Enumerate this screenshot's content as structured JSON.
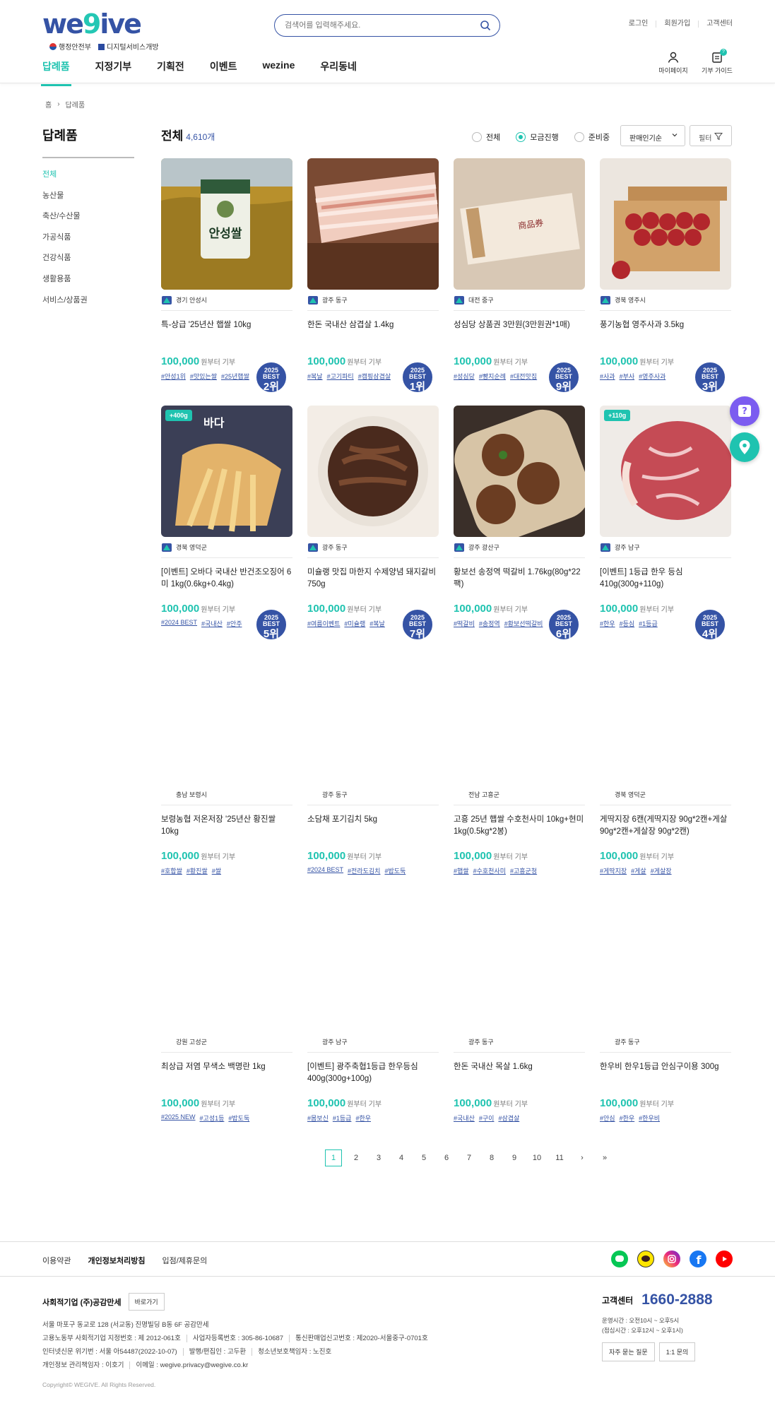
{
  "header": {
    "logo": {
      "part1": "we",
      "part2": "9",
      "part3": "ive"
    },
    "logo_sub": [
      "행정안전부",
      "디지털서비스개방"
    ],
    "search_placeholder": "검색어를 입력해주세요.",
    "top_links": [
      "로그인",
      "회원가입",
      "고객센터"
    ],
    "nav": [
      "답례품",
      "지정기부",
      "기획전",
      "이벤트",
      "wezine",
      "우리동네"
    ],
    "icons": [
      {
        "label": "마이페이지",
        "icon": "user-icon"
      },
      {
        "label": "기부 가이드",
        "icon": "guide-icon"
      }
    ],
    "guide_badge": "?"
  },
  "breadcrumb": [
    "홈",
    "답례품"
  ],
  "sidebar": {
    "title": "답례품",
    "items": [
      "전체",
      "농산물",
      "축산/수산물",
      "가공식품",
      "건강식품",
      "생활용품",
      "서비스/상품권"
    ]
  },
  "list": {
    "title": "전체",
    "count": "4,610개",
    "filters": [
      "전체",
      "모금진행",
      "준비중"
    ],
    "selected_filter": "모금진행",
    "sort": "판매인기순",
    "filter_btn": "필터"
  },
  "products": [
    {
      "region": "경기 안성시",
      "name": "특-상급 '25년산 햅쌀 10kg",
      "price": "100,000",
      "unit": "원부터 기부",
      "tags": [
        "#안성1위",
        "#맛있는쌀",
        "#25년햅쌀"
      ],
      "badge_top": "2025",
      "badge_mid": "BEST",
      "rank": "2위",
      "plus": "",
      "img": "rice"
    },
    {
      "region": "광주 동구",
      "name": "한돈 국내산 삼겹살 1.4kg",
      "price": "100,000",
      "unit": "원부터 기부",
      "tags": [
        "#복날",
        "#고기파티",
        "#캠핑삼겹살"
      ],
      "badge_top": "2025",
      "badge_mid": "BEST",
      "rank": "1위",
      "plus": "",
      "img": "pork"
    },
    {
      "region": "대전 중구",
      "name": "성심당 상품권 3만원(3만원권*1매)",
      "price": "100,000",
      "unit": "원부터 기부",
      "tags": [
        "#성심당",
        "#빵지순례",
        "#대전맛집"
      ],
      "badge_top": "2025",
      "badge_mid": "BEST",
      "rank": "9위",
      "plus": "",
      "img": "voucher"
    },
    {
      "region": "경북 영주시",
      "name": "풍기농협 영주사과 3.5kg",
      "price": "100,000",
      "unit": "원부터 기부",
      "tags": [
        "#사과",
        "#부사",
        "#영주사과"
      ],
      "badge_top": "2025",
      "badge_mid": "BEST",
      "rank": "3위",
      "plus": "",
      "img": "apple"
    },
    {
      "region": "경북 영덕군",
      "name": "[이벤트] 오바다 국내산 반건조오징어 6미 1kg(0.6kg+0.4kg)",
      "price": "100,000",
      "unit": "원부터 기부",
      "tags": [
        "#2024 BEST",
        "#국내산",
        "#안주"
      ],
      "badge_top": "2025",
      "badge_mid": "BEST",
      "rank": "5위",
      "plus": "+400g",
      "img": "squid"
    },
    {
      "region": "광주 동구",
      "name": "미슐랭 맛집 마한지 수제양념 돼지갈비 750g",
      "price": "100,000",
      "unit": "원부터 기부",
      "tags": [
        "#여름이벤트",
        "#미슐랭",
        "#복날"
      ],
      "badge_top": "2025",
      "badge_mid": "BEST",
      "rank": "7위",
      "plus": "",
      "img": "galbi"
    },
    {
      "region": "광주 광산구",
      "name": "황보선 송정역 떡갈비 1.76kg(80g*22팩)",
      "price": "100,000",
      "unit": "원부터 기부",
      "tags": [
        "#떡갈비",
        "#송정역",
        "#황보선떡갈비"
      ],
      "badge_top": "2025",
      "badge_mid": "BEST",
      "rank": "6위",
      "plus": "",
      "img": "tteok"
    },
    {
      "region": "광주 남구",
      "name": "[이벤트] 1등급 한우 등심 410g(300g+110g)",
      "price": "100,000",
      "unit": "원부터 기부",
      "tags": [
        "#한우",
        "#등심",
        "#1등급"
      ],
      "badge_top": "2025",
      "badge_mid": "BEST",
      "rank": "4위",
      "plus": "+110g",
      "img": "beef"
    },
    {
      "region": "충남 보령시",
      "name": "보령농협 저온저장 '25년산 황진쌀10kg",
      "price": "100,000",
      "unit": "원부터 기부",
      "tags": [
        "#호합쌀",
        "#황진쌀",
        "#쌀"
      ],
      "badge_top": "",
      "badge_mid": "",
      "rank": "",
      "plus": "",
      "img": ""
    },
    {
      "region": "광주 동구",
      "name": "소담채 포기김치 5kg",
      "price": "100,000",
      "unit": "원부터 기부",
      "tags": [
        "#2024 BEST",
        "#전라도김치",
        "#밥도둑"
      ],
      "badge_top": "",
      "badge_mid": "",
      "rank": "",
      "plus": "",
      "img": ""
    },
    {
      "region": "전남 고흥군",
      "name": "고흥 25년 햅쌀 수호천사미 10kg+현미1kg(0.5kg*2봉)",
      "price": "100,000",
      "unit": "원부터 기부",
      "tags": [
        "#햅쌀",
        "#수호천사미",
        "#고흥군청"
      ],
      "badge_top": "",
      "badge_mid": "",
      "rank": "",
      "plus": "",
      "img": ""
    },
    {
      "region": "경북 영덕군",
      "name": "게딱지장 6캔(게딱지장 90g*2캔+게살90g*2캔+게살장 90g*2캔)",
      "price": "100,000",
      "unit": "원부터 기부",
      "tags": [
        "#게딱지장",
        "#게살",
        "#게살장"
      ],
      "badge_top": "",
      "badge_mid": "",
      "rank": "",
      "plus": "",
      "img": ""
    },
    {
      "region": "강원 고성군",
      "name": "최상급 저염 무색소 백명란 1kg",
      "price": "100,000",
      "unit": "원부터 기부",
      "tags": [
        "#2025 NEW",
        "#고성1등",
        "#밥도둑"
      ],
      "badge_top": "",
      "badge_mid": "",
      "rank": "",
      "plus": "",
      "img": ""
    },
    {
      "region": "광주 남구",
      "name": "[이벤트] 광주축협1등급 한우등심 400g(300g+100g)",
      "price": "100,000",
      "unit": "원부터 기부",
      "tags": [
        "#몸보신",
        "#1등급",
        "#한우"
      ],
      "badge_top": "",
      "badge_mid": "",
      "rank": "",
      "plus": "",
      "img": ""
    },
    {
      "region": "광주 동구",
      "name": "한돈 국내산 목살 1.6kg",
      "price": "100,000",
      "unit": "원부터 기부",
      "tags": [
        "#국내산",
        "#구이",
        "#삼겹살"
      ],
      "badge_top": "",
      "badge_mid": "",
      "rank": "",
      "plus": "",
      "img": ""
    },
    {
      "region": "광주 동구",
      "name": "한우비 한우1등급 안심구이용 300g",
      "price": "100,000",
      "unit": "원부터 기부",
      "tags": [
        "#안심",
        "#한우",
        "#한우비"
      ],
      "badge_top": "",
      "badge_mid": "",
      "rank": "",
      "plus": "",
      "img": ""
    }
  ],
  "pagination": {
    "pages": [
      "1",
      "2",
      "3",
      "4",
      "5",
      "6",
      "7",
      "8",
      "9",
      "10",
      "11"
    ],
    "current": "1",
    "next": "›",
    "last": "»"
  },
  "footer": {
    "links": [
      "이용약관",
      "개인정보처리방침",
      "입점/제휴문의"
    ],
    "corp": "사회적기업 (주)공감만세",
    "go_btn": "바로가기",
    "info": [
      [
        "서울 마포구 동교로 128 (서교동) 진명빌딩 B동 6F 공감만세"
      ],
      [
        "고용노동부 사회적기업 지정번호 : 제 2012-061호",
        "사업자등록번호 : 305-86-10687",
        "통신판매업신고번호 : 제2020-서울중구-0701호"
      ],
      [
        "인터넷신문 위기번 : 서울 아54487(2022-10-07)",
        "발행/편집인 : 고두환",
        "청소년보호책임자 : 노진호"
      ],
      [
        "개인정보 관리책임자 : 이호기",
        "이메일 : wegive.privacy@wegive.co.kr"
      ]
    ],
    "copyright": "Copyright© WEGIVE. All Rights Reserved.",
    "cs_title": "고객센터",
    "cs_number": "1660-2888",
    "cs_hours": [
      "운영시간 : 오전10시 ~ 오후5시",
      "(점심시간 : 오후12시 ~ 오후1시)"
    ],
    "cs_buttons": [
      "자주 묻는 질문",
      "1:1 문의"
    ],
    "sns": [
      "line-icon",
      "kakao-icon",
      "instagram-icon",
      "facebook-icon",
      "youtube-icon"
    ]
  },
  "colors": {
    "accent": "#1fc3b0",
    "brand": "#3553a5"
  }
}
